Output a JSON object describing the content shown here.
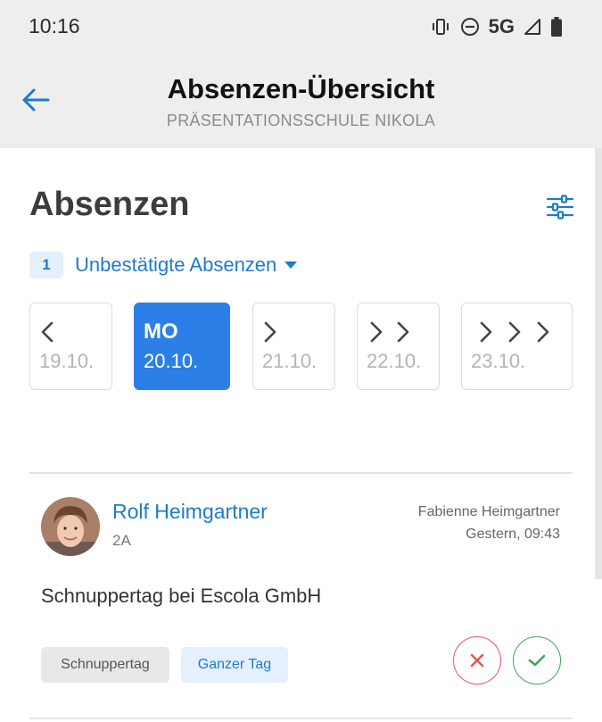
{
  "status_bar": {
    "time": "10:16",
    "network": "5G",
    "icons": [
      "vibrate-icon",
      "dnd-icon",
      "signal-icon",
      "battery-icon"
    ]
  },
  "app_bar": {
    "back_icon": "arrow-left-icon",
    "title": "Absenzen-Übersicht",
    "subtitle": "PRÄSENTATIONSSCHULE NIKOLA"
  },
  "page": {
    "heading": "Absenzen",
    "filter_icon": "sliders-icon"
  },
  "unconfirmed": {
    "count": "1",
    "label": "Unbestätigte Absenzen",
    "caret_icon": "caret-down-icon"
  },
  "days": [
    {
      "icon": "chevron-left-icon",
      "label": "",
      "date": "19.10.",
      "active": false
    },
    {
      "icon": "",
      "label": "MO",
      "date": "20.10.",
      "active": true
    },
    {
      "icon": "chevron-right-icon",
      "label": "",
      "date": "21.10.",
      "active": false
    },
    {
      "icon": "double-chevron-right-icon",
      "label": "",
      "date": "22.10.",
      "active": false
    },
    {
      "icon": "triple-chevron-right-icon",
      "label": "",
      "date": "23.10.",
      "active": false
    }
  ],
  "absence": {
    "student_name": "Rolf Heimgartner",
    "student_class": "2A",
    "reporter": "Fabienne Heimgartner",
    "reported_at": "Gestern, 09:43",
    "reason": "Schnuppertag bei Escola GmbH",
    "tags": [
      "Schnuppertag",
      "Ganzer Tag"
    ],
    "reject_icon": "close-icon",
    "confirm_icon": "check-icon"
  },
  "colors": {
    "accent": "#2d7fe8",
    "link": "#1d7bd0",
    "reject": "#e15a5a",
    "confirm": "#3ea75a",
    "header_bg": "#eeeeee"
  }
}
